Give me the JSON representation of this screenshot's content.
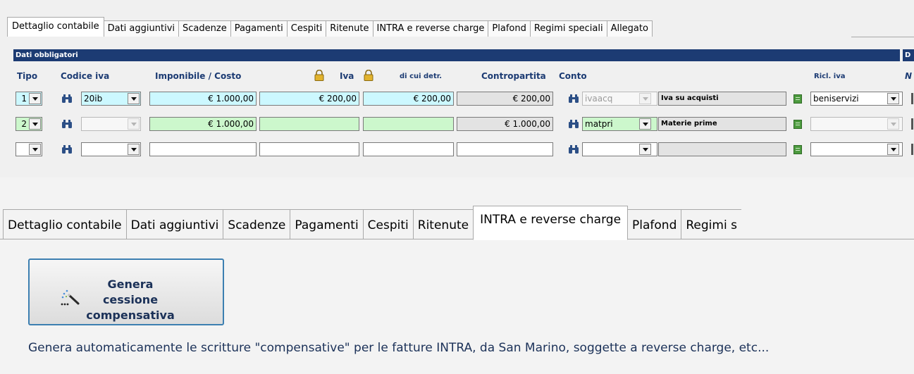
{
  "top_tabs": [
    "Dettaglio contabile",
    "Dati aggiuntivi",
    "Scadenze",
    "Pagamenti",
    "Cespiti",
    "Ritenute",
    "INTRA e reverse charge",
    "Plafond",
    "Regimi speciali",
    "Allegato"
  ],
  "section": {
    "title": "Dati obbligatori",
    "right_stub": "D"
  },
  "headers": {
    "tipo": "Tipo",
    "codice_iva": "Codice iva",
    "imponibile": "Imponibile / Costo",
    "iva": "Iva",
    "detr": "di cui detr.",
    "contropartita": "Contropartita",
    "conto": "Conto",
    "ricl_iva": "Ricl. iva",
    "extra": "N"
  },
  "rows": [
    {
      "tipo": "1",
      "codice_iva": "20ib",
      "imponibile": "€ 1.000,00",
      "iva": "€ 200,00",
      "detr": "€ 200,00",
      "contropartita": "€ 200,00",
      "conto": "ivaacq",
      "conto_desc": "Iva su acquisti",
      "ricl": "beniservizi"
    },
    {
      "tipo": "2",
      "codice_iva": "",
      "imponibile": "€ 1.000,00",
      "iva": "",
      "detr": "",
      "contropartita": "€ 1.000,00",
      "conto": "matpri",
      "conto_desc": "Materie prime",
      "ricl": ""
    },
    {
      "tipo": "",
      "codice_iva": "",
      "imponibile": "",
      "iva": "",
      "detr": "",
      "contropartita": "",
      "conto": "",
      "conto_desc": "",
      "ricl": ""
    }
  ],
  "bottom_tabs": [
    "Dettaglio contabile",
    "Dati aggiuntivi",
    "Scadenze",
    "Pagamenti",
    "Cespiti",
    "Ritenute",
    "INTRA e reverse charge",
    "Plafond",
    "Regimi s"
  ],
  "active_bottom_tab": "INTRA e reverse charge",
  "generate_button": {
    "line1": "Genera cessione",
    "line2": "compensativa",
    "icon": "magic-wand-icon"
  },
  "description": "Genera automaticamente le scritture \"compensative\" per le fatture INTRA, da San Marino, soggette a reverse charge, etc...",
  "colors": {
    "header_bar": "#1c3b73",
    "cyan_field": "#ccf8ff",
    "green_field": "#ccf7cc",
    "button_border": "#3c7fb1"
  }
}
